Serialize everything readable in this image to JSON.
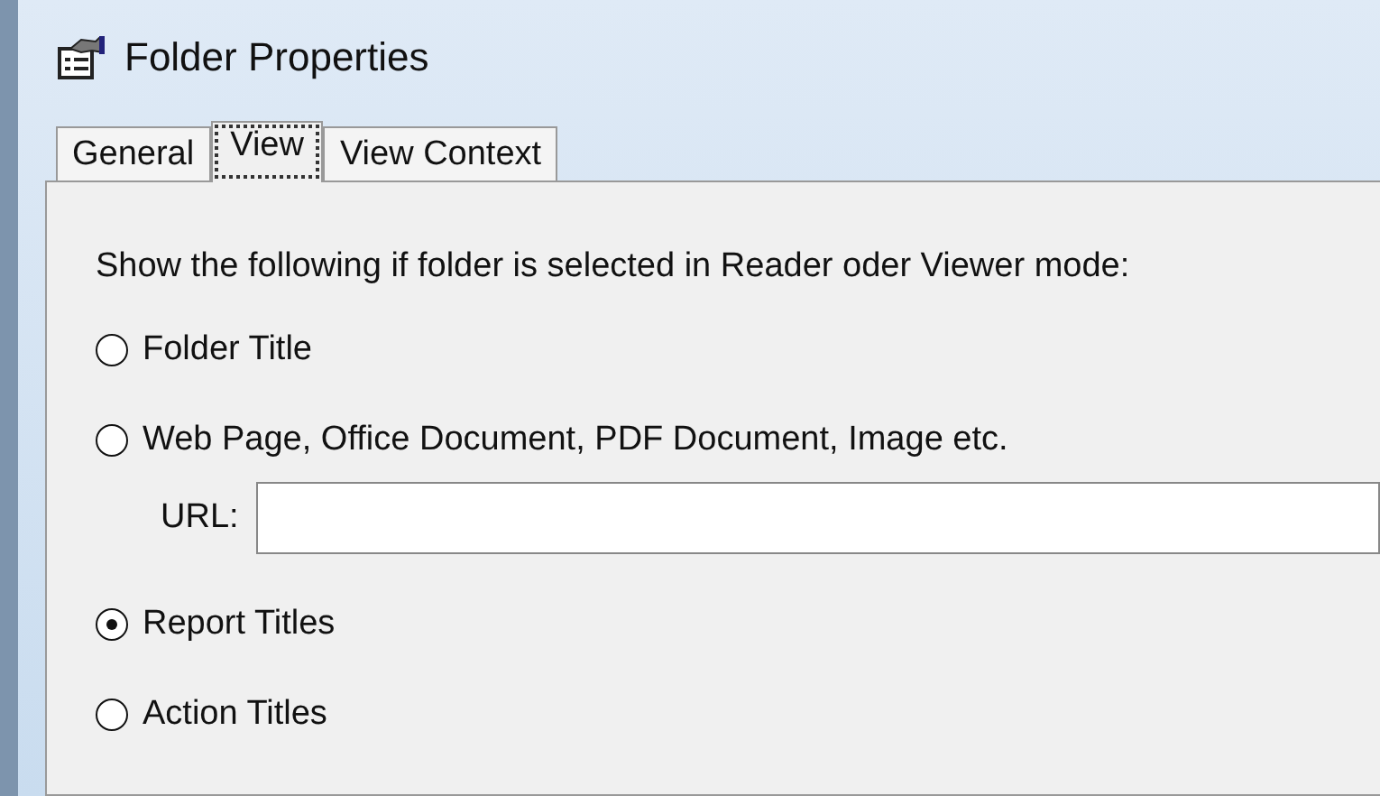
{
  "window": {
    "title": "Folder Properties"
  },
  "tabs": [
    {
      "label": "General",
      "selected": false
    },
    {
      "label": "View",
      "selected": true
    },
    {
      "label": "View Context",
      "selected": false
    }
  ],
  "prompt": "Show the following if folder is selected in Reader oder Viewer mode:",
  "options": [
    {
      "label": "Folder Title",
      "selected": false
    },
    {
      "label": "Web Page, Office Document, PDF Document, Image etc.",
      "selected": false,
      "field": {
        "label": "URL:"
      }
    },
    {
      "label": "Report Titles",
      "selected": true
    },
    {
      "label": "Action Titles",
      "selected": false
    }
  ]
}
